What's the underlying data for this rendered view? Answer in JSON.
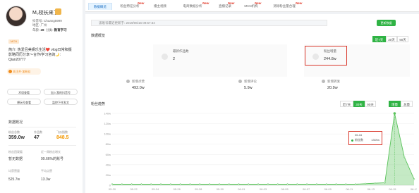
{
  "profile": {
    "name": "M₀校长来了",
    "id_label": "抖音号:",
    "id_value": "Chuang5999",
    "region_label": "地区:",
    "region_value": "广州",
    "age_label": "年龄:",
    "age_value": "28",
    "cat_label": "分类:",
    "cat_value": "教育学习",
    "tag": "MCN",
    "bio_lines": [
      "简介: 热爱且美娱乐生活❤️ vlog日常和摄",
      "影略同历分享～合作/学习咨询🌙:",
      "Qian20777"
    ],
    "follow_label": "关注并·加粉丝",
    "actions": {
      "a1": "术语查看",
      "a2": "加入我的抖音号",
      "a3": "想玩号查看",
      "a4": "监控下任发文"
    },
    "stats_title": "数据概况",
    "stats": [
      {
        "label": "粉丝总数",
        "value": "359.0w"
      },
      {
        "label": "作品数",
        "value": "47"
      },
      {
        "label": "飞瓜指数",
        "value": "848.5"
      }
    ],
    "stats2": [
      {
        "label": "粉丝团观看",
        "value": "暂无数据"
      },
      {
        "label": "近一周粉丝增长",
        "value": "99.66%的账号"
      }
    ],
    "stats3": [
      {
        "label": "均获赞量",
        "value": "525.7w"
      },
      {
        "label": "平均点赞",
        "value": "13.3w"
      }
    ]
  },
  "tabs": [
    {
      "label": "数据概览",
      "active": true
    },
    {
      "label": "粉丝特征分析",
      "new": "New"
    },
    {
      "label": "播主视频"
    },
    {
      "label": "电商数据分析",
      "new": "New"
    },
    {
      "label": "直播记录",
      "new": "New"
    },
    {
      "label": "MCN机构",
      "new": "New"
    },
    {
      "label": "消除粉丝量合理",
      "new": "New"
    }
  ],
  "main": {
    "infobar": "该账号最近更新于: 2019/06/16 09:57:34",
    "update_btn": "更新数据",
    "section1_title": "数据概览",
    "range1": [
      "近7天",
      "30天",
      "90天"
    ],
    "cards": [
      {
        "label": "最新作品数",
        "value": "2"
      },
      {
        "label": "粉丝增量",
        "value": "244.8w"
      }
    ],
    "metrics": [
      {
        "label": "新增点赞",
        "value": "492.0w"
      },
      {
        "label": "新增评论",
        "value": "5.9w"
      },
      {
        "label": "新增转发",
        "value": "20.9w"
      }
    ],
    "section2_title": "粉丝趋势",
    "range2": [
      "近7天",
      "30天",
      "90天"
    ],
    "mode": [
      "增量",
      "总量"
    ]
  },
  "chart_data": {
    "type": "area",
    "y_ticks": [
      "0",
      "20w",
      "40w",
      "60w",
      "80w",
      "100w",
      "120w",
      "140w"
    ],
    "ylim": [
      0,
      140
    ],
    "x_ticks": [
      "05-20",
      "05-22",
      "05-24",
      "05-26",
      "05-28",
      "05-30",
      "06-01",
      "06-03",
      "06-05",
      "06-07",
      "06-09",
      "06-11",
      "06-13",
      "06-15",
      "06-17"
    ],
    "series": [
      {
        "name": "粉丝数",
        "values": [
          2,
          2,
          2,
          2,
          2,
          2,
          2,
          2,
          2,
          2,
          2,
          2,
          2,
          2,
          2,
          2,
          2,
          2,
          2,
          2,
          2,
          2,
          2,
          2,
          2,
          2,
          3,
          4,
          5,
          140,
          55,
          12
        ]
      }
    ],
    "tooltip": {
      "date": "06-16",
      "label": "粉丝数",
      "value": "1369w"
    },
    "color": "#59c35a"
  }
}
